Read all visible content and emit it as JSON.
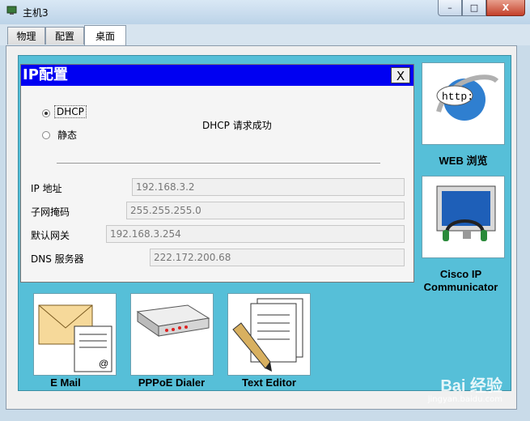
{
  "window": {
    "title": "主机3",
    "minimize_glyph": "–",
    "maximize_glyph": "□",
    "close_glyph": "X"
  },
  "tabs": [
    {
      "label": "物理",
      "active": false
    },
    {
      "label": "配置",
      "active": false
    },
    {
      "label": "桌面",
      "active": true
    }
  ],
  "dialog": {
    "title": "IP配置",
    "close_label": "X",
    "mode_options": [
      {
        "label": "DHCP",
        "selected": true
      },
      {
        "label": "静态",
        "selected": false
      }
    ],
    "status": "DHCP 请求成功",
    "fields": [
      {
        "label": "IP 地址",
        "value": "192.168.3.2"
      },
      {
        "label": "子网掩码",
        "value": "255.255.255.0"
      },
      {
        "label": "默认网关",
        "value": "192.168.3.254"
      },
      {
        "label": "DNS 服务器",
        "value": "222.172.200.68"
      }
    ]
  },
  "desktop_apps": {
    "web_browser": {
      "label": "WEB 浏览",
      "icon": "http-globe-icon",
      "icon_text": "http:"
    },
    "ip_communicator": {
      "label": "Cisco IP Communicator",
      "icon": "ip-phone-monitor-icon"
    },
    "email": {
      "label": "E Mail",
      "icon": "envelope-icon"
    },
    "pppoe": {
      "label": "PPPoE Dialer",
      "icon": "modem-icon"
    },
    "text_editor": {
      "label": "Text Editor",
      "icon": "pen-paper-icon"
    }
  },
  "watermark": {
    "brand": "Bai 经验",
    "url": "jingyan.baidu.com"
  },
  "colors": {
    "desktop_bg": "#56bfd8",
    "dialog_title_bg": "#0000f2",
    "close_btn": "#c4402a"
  }
}
